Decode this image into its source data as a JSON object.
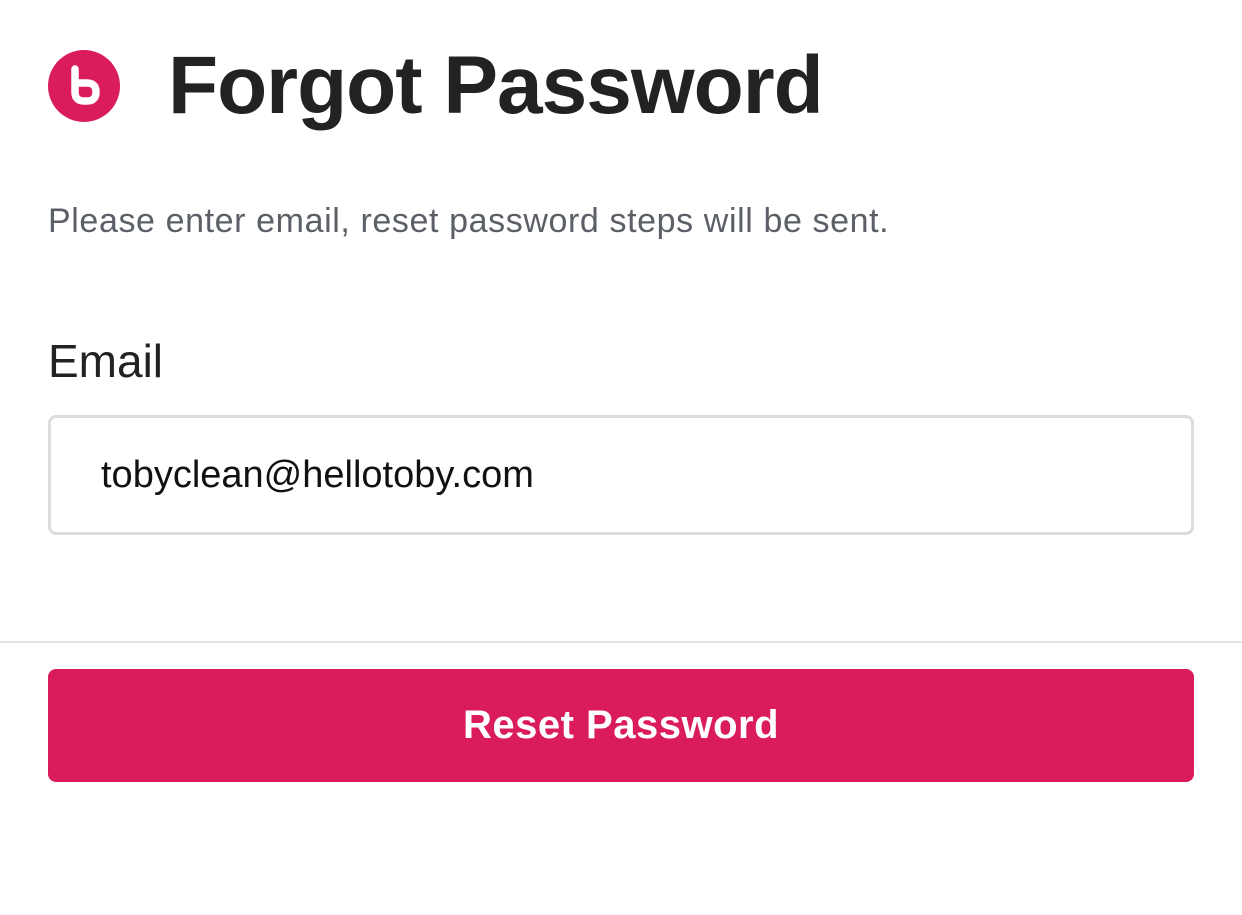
{
  "header": {
    "logo_icon": "toby-logo-icon",
    "title": "Forgot Password"
  },
  "instructions": "Please enter email, reset password steps will be sent.",
  "form": {
    "email_label": "Email",
    "email_value": "tobyclean@hellotoby.com"
  },
  "actions": {
    "reset_label": "Reset Password"
  },
  "colors": {
    "brand": "#da1c5c",
    "title_text": "#222222",
    "muted_text": "#5b5f66",
    "input_border": "#dcdcdc",
    "divider": "#e2e2e2"
  }
}
